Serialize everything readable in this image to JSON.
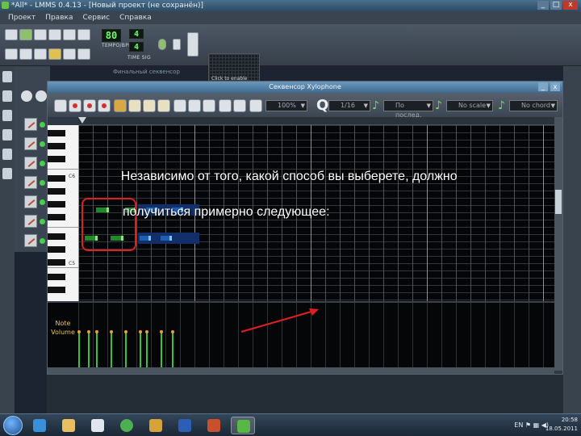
{
  "window": {
    "title": "*All* - LMMS 0.4.13 - [Новый проект (не сохранён)]",
    "buttons": [
      "_",
      "□",
      "x"
    ]
  },
  "menubar": {
    "items": [
      "Проект",
      "Правка",
      "Сервис",
      "Справка"
    ]
  },
  "main_toolbar": {
    "tempo_value": "80",
    "tempo_label": "TEMPO/BPM",
    "time_sig_top": "4",
    "time_sig_bottom": "4",
    "time_sig_label": "TIME SIG",
    "graph_label": "Click to enable"
  },
  "fx_panel_title": "Финальный секвенсор",
  "piano_roll": {
    "title": "Секвенсор Xylophone",
    "zoom_value": "100%",
    "quantize_letter": "Q",
    "quantize_value": "1/16",
    "note_length_value": "По послед.",
    "scale_value": "No scale",
    "chord_value": "No chord",
    "key_labels": [
      "C6",
      "C5"
    ],
    "automation_label_line1": "Note",
    "automation_label_line2": "Volume"
  },
  "overlay_caption": {
    "line1": "Независимо от того, какой способ вы выберете, должно",
    "line2": "получиться примерно следующее:"
  },
  "taskbar": {
    "lang": "EN",
    "time": "20:58",
    "date": "18.05.2011"
  },
  "colors": {
    "note_selected": "#1f8a2a",
    "note_unselected": "#1d5fb0",
    "annotation_red": "#e02020",
    "velocity_bar": "#39c23a",
    "automation_label": "#e6c84a"
  }
}
